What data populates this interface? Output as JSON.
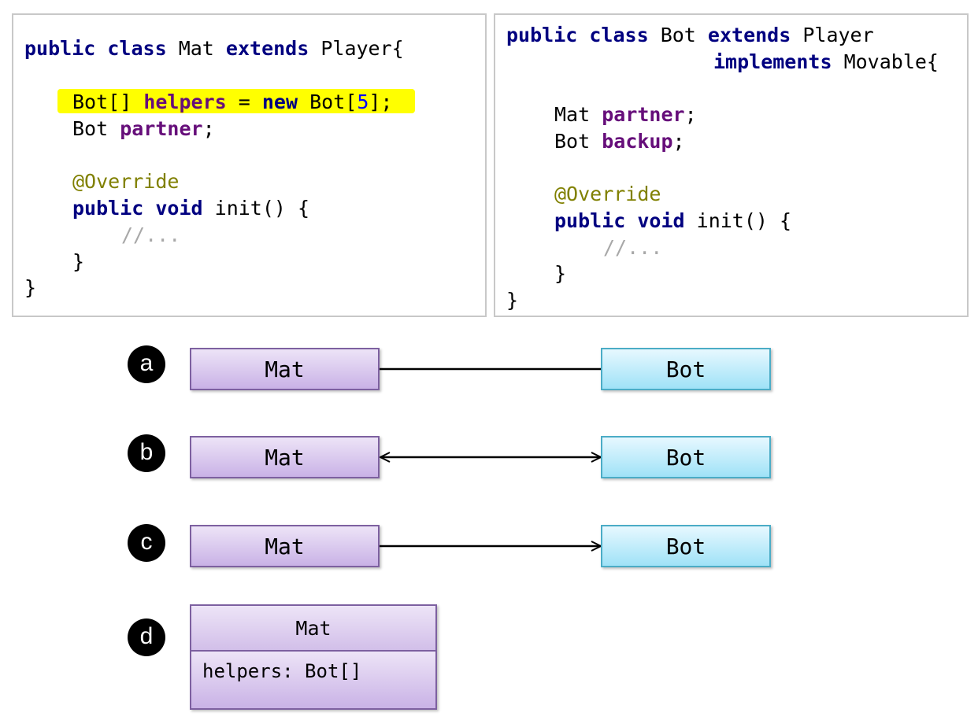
{
  "left_code": {
    "line1": {
      "kw1": "public",
      "kw2": "class",
      "name": "Mat",
      "kw3": "extends",
      "parent": "Player{"
    },
    "line2": {
      "type": "Bot[]",
      "field": "helpers",
      "eq": "=",
      "kw": "new",
      "ctor": "Bot[",
      "num": "5",
      "end": "];"
    },
    "line3": {
      "type": "Bot",
      "field": "partner",
      "end": ";"
    },
    "annotation": "@Override",
    "method": {
      "kw1": "public",
      "kw2": "void",
      "sig": "init() {"
    },
    "comment": "//...",
    "close_inner": "}",
    "close_outer": "}"
  },
  "right_code": {
    "line1": {
      "kw1": "public",
      "kw2": "class",
      "name": "Bot",
      "kw3": "extends",
      "parent": "Player"
    },
    "line2": {
      "kw": "implements",
      "iface": "Movable{"
    },
    "line3": {
      "type": "Mat",
      "field": "partner",
      "end": ";"
    },
    "line4": {
      "type": "Bot",
      "field": "backup",
      "end": ";"
    },
    "annotation": "@Override",
    "method": {
      "kw1": "public",
      "kw2": "void",
      "sig": "init() {"
    },
    "comment": "//...",
    "close_inner": "}",
    "close_outer": "}"
  },
  "options": [
    {
      "letter": "a",
      "left": "Mat",
      "right": "Bot",
      "link": "plain"
    },
    {
      "letter": "b",
      "left": "Mat",
      "right": "Bot",
      "link": "bidirectional"
    },
    {
      "letter": "c",
      "left": "Mat",
      "right": "Bot",
      "link": "navigable-to-right"
    },
    {
      "letter": "d",
      "class_name": "Mat",
      "attribute": "helpers: Bot[]"
    }
  ],
  "colors": {
    "keyword": "#000080",
    "field": "#660e7a",
    "annotation": "#808000",
    "comment": "#a8a8a8",
    "number": "#0000ff",
    "highlight": "#ffff00",
    "mat_fill": "#c9b2e6",
    "bot_fill": "#9fe2f7"
  }
}
